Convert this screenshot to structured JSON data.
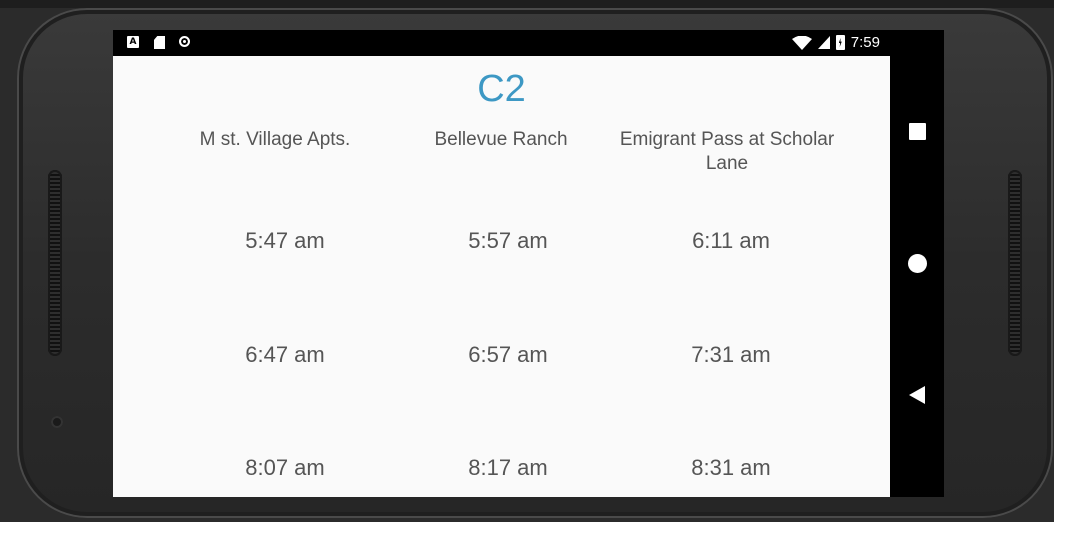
{
  "status_bar": {
    "time": "7:59",
    "notification_icons": [
      "android-a-icon",
      "sd-card-icon",
      "record-icon"
    ],
    "system_icons": [
      "wifi-icon",
      "signal-icon",
      "battery-charging-icon"
    ]
  },
  "route": {
    "title": "C2"
  },
  "schedule": {
    "stops": [
      "M st. Village Apts.",
      "Bellevue Ranch",
      "Emigrant Pass at Scholar Lane"
    ],
    "rows": [
      [
        "5:47 am",
        "5:57 am",
        "6:11 am"
      ],
      [
        "6:47 am",
        "6:57 am",
        "7:31 am"
      ],
      [
        "8:07 am",
        "8:17 am",
        "8:31 am"
      ]
    ]
  },
  "nav_bar": {
    "buttons": [
      "overview-square-icon",
      "home-circle-icon",
      "back-triangle-icon"
    ]
  },
  "colors": {
    "title": "#3d98c4",
    "text": "#555555",
    "screen_bg": "#fafafa"
  }
}
